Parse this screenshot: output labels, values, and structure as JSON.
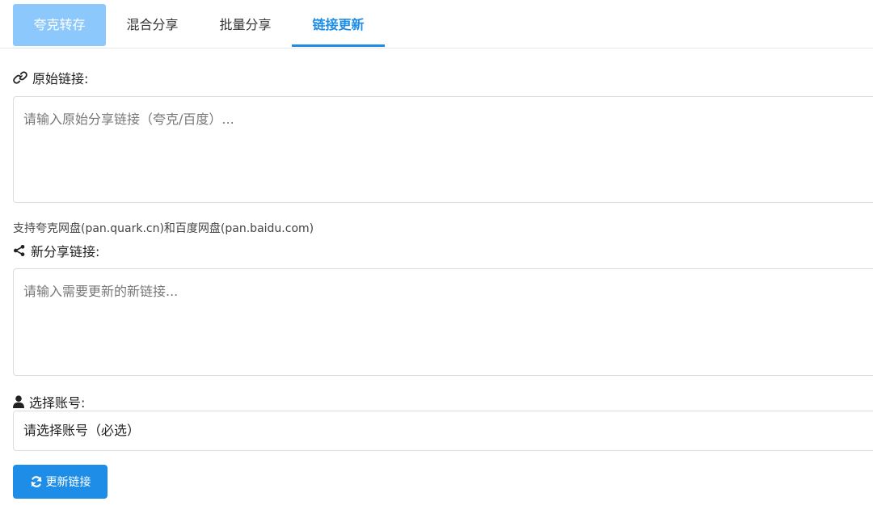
{
  "tabs": {
    "quark_transfer": "夸克转存",
    "mixed_share": "混合分享",
    "batch_share": "批量分享",
    "link_update": "链接更新"
  },
  "original_link": {
    "label": "原始链接:",
    "placeholder": "请输入原始分享链接（夸克/百度）...",
    "hint": "支持夸克网盘(pan.quark.cn)和百度网盘(pan.baidu.com)"
  },
  "new_link": {
    "label": "新分享链接:",
    "placeholder": "请输入需要更新的新链接..."
  },
  "account": {
    "label": "选择账号:",
    "selected": "请选择账号（必选）"
  },
  "submit": {
    "label": "更新链接"
  },
  "icons": {
    "original_link_icon": "link-icon",
    "new_link_icon": "share-icon",
    "account_icon": "user-icon",
    "submit_icon": "refresh-icon"
  },
  "colors": {
    "accent": "#1e8de8",
    "tab_inactive_bg": "#8cc8fb"
  }
}
